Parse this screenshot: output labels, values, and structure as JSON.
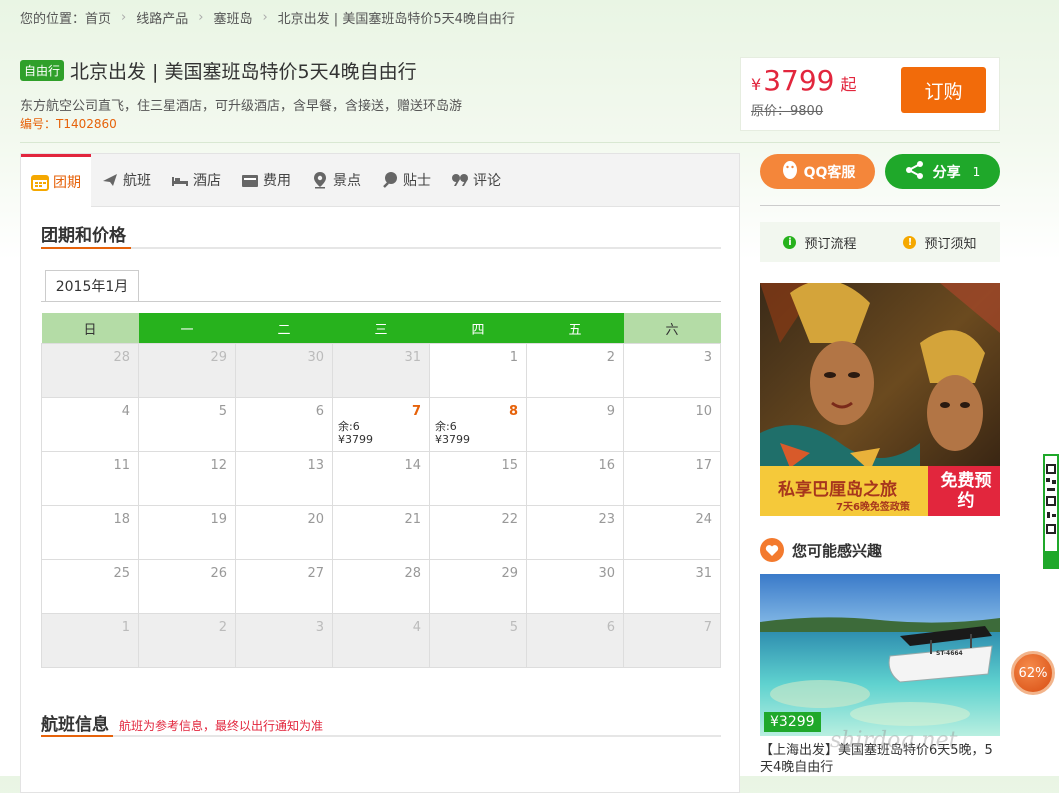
{
  "breadcrumb": {
    "prefix": "您的位置：",
    "items": [
      "首页",
      "线路产品",
      "塞班岛",
      "北京出发 | 美国塞班岛特价5天4晚自由行"
    ]
  },
  "product": {
    "tag": "自由行",
    "title": "北京出发 | 美国塞班岛特价5天4晚自由行",
    "description": "东方航空公司直飞，住三星酒店，可升级酒店，含早餐，含接送，赠送环岛游",
    "code": "编号：T1402860"
  },
  "pricebox": {
    "currency": "¥",
    "price": "3799",
    "suffix": "起",
    "original": "原价：9800",
    "order_label": "订购"
  },
  "tabs": [
    {
      "label": "团期",
      "icon": "calendar-icon"
    },
    {
      "label": "航班",
      "icon": "plane-icon"
    },
    {
      "label": "酒店",
      "icon": "bed-icon"
    },
    {
      "label": "费用",
      "icon": "wallet-icon"
    },
    {
      "label": "景点",
      "icon": "map-pin-icon"
    },
    {
      "label": "贴士",
      "icon": "bulb-icon"
    },
    {
      "label": "评论",
      "icon": "quote-icon"
    }
  ],
  "schedule": {
    "title": "团期和价格",
    "month": "2015年1月",
    "weekdays": [
      "日",
      "一",
      "二",
      "三",
      "四",
      "五",
      "六"
    ],
    "weeks": [
      [
        {
          "d": "28",
          "o": 1
        },
        {
          "d": "29",
          "o": 1
        },
        {
          "d": "30",
          "o": 1
        },
        {
          "d": "31",
          "o": 1
        },
        {
          "d": "1"
        },
        {
          "d": "2"
        },
        {
          "d": "3"
        }
      ],
      [
        {
          "d": "4"
        },
        {
          "d": "5"
        },
        {
          "d": "6"
        },
        {
          "d": "7",
          "hl": 1,
          "rem": "余:6",
          "price": "¥3799"
        },
        {
          "d": "8",
          "hl": 1,
          "rem": "余:6",
          "price": "¥3799"
        },
        {
          "d": "9"
        },
        {
          "d": "10"
        }
      ],
      [
        {
          "d": "11"
        },
        {
          "d": "12"
        },
        {
          "d": "13"
        },
        {
          "d": "14"
        },
        {
          "d": "15"
        },
        {
          "d": "16"
        },
        {
          "d": "17"
        }
      ],
      [
        {
          "d": "18"
        },
        {
          "d": "19"
        },
        {
          "d": "20"
        },
        {
          "d": "21"
        },
        {
          "d": "22"
        },
        {
          "d": "23"
        },
        {
          "d": "24"
        }
      ],
      [
        {
          "d": "25"
        },
        {
          "d": "26"
        },
        {
          "d": "27"
        },
        {
          "d": "28"
        },
        {
          "d": "29"
        },
        {
          "d": "30"
        },
        {
          "d": "31"
        }
      ],
      [
        {
          "d": "1",
          "o": 1
        },
        {
          "d": "2",
          "o": 1
        },
        {
          "d": "3",
          "o": 1
        },
        {
          "d": "4",
          "o": 1
        },
        {
          "d": "5",
          "o": 1
        },
        {
          "d": "6",
          "o": 1
        },
        {
          "d": "7",
          "o": 1
        }
      ]
    ]
  },
  "flight": {
    "title": "航班信息",
    "note": "航班为参考信息，最终以出行通知为准"
  },
  "sidebar": {
    "qq_label": "QQ客服",
    "share_label": "分享",
    "share_count": "1",
    "links": [
      "预订流程",
      "预订须知"
    ],
    "banner": {
      "title": "私享巴厘岛之旅",
      "subtitle": "7天6晚免签政策",
      "badge": "免费预约"
    },
    "interest_title": "您可能感兴趣",
    "product": {
      "price": "¥3299",
      "title": "【上海出发】美国塞班岛特价6天5晚，5天4晚自由行",
      "boat_label": "ST-4664"
    }
  },
  "progress_badge": "62%",
  "watermark": "shirdog.net",
  "colors": {
    "accent": "#e6620a",
    "brand_green": "#27b21d",
    "price_red": "#e2263d",
    "order_orange": "#f26b0a"
  }
}
